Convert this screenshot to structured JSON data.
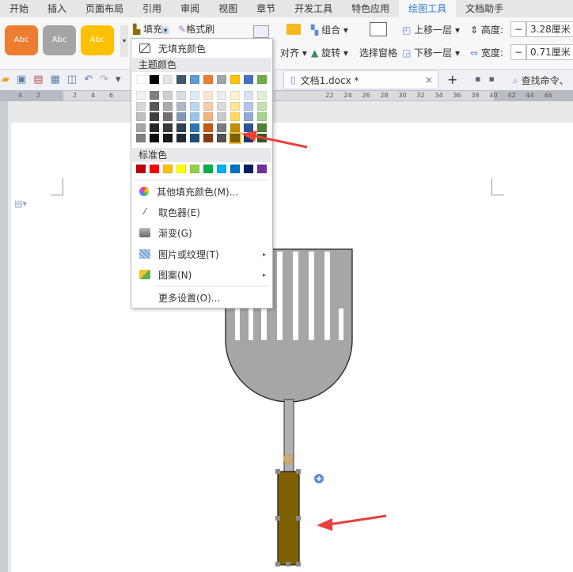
{
  "tabs": [
    "开始",
    "插入",
    "页面布局",
    "引用",
    "审阅",
    "视图",
    "章节",
    "开发工具",
    "特色应用",
    "绘图工具",
    "文档助手"
  ],
  "active_tab": "绘图工具",
  "ribbon": {
    "styles": [
      {
        "label": "Abc",
        "color": "#ed7d31"
      },
      {
        "label": "Abc",
        "color": "#a5a5a5"
      },
      {
        "label": "Abc",
        "color": "#ffc000"
      }
    ],
    "fill": "填充",
    "format_painter": "格式刷",
    "align": "对齐",
    "group": "组合",
    "rotate": "旋转",
    "selection_pane": "选择窗格",
    "bring_forward": "上移一层",
    "send_backward": "下移一层",
    "height_label": "高度:",
    "height_value": "3.28厘米",
    "width_label": "宽度:",
    "width_value": "0.71厘米",
    "minus": "−"
  },
  "doc_tab": {
    "title": "文档1.docx *",
    "close": "×",
    "add": "+"
  },
  "search": "查找命令、",
  "ruler_ticks": [
    "4",
    "2",
    "",
    "2",
    "4",
    "6",
    "",
    "",
    "",
    "",
    "",
    "",
    "",
    "",
    "",
    "",
    "",
    "22",
    "24",
    "26",
    "28",
    "30",
    "32",
    "34",
    "36",
    "38",
    "40",
    "42",
    "44",
    "46"
  ],
  "menu": {
    "no_fill": "无填充颜色",
    "theme_header": "主题颜色",
    "standard_header": "标准色",
    "more_colors": "其他填充颜色(M)...",
    "eyedropper": "取色器(E)",
    "gradient": "渐变(G)",
    "picture": "图片或纹理(T)",
    "pattern": "图案(N)",
    "more_settings": "更多设置(O)...",
    "theme_colors": [
      "#ffffff",
      "#000000",
      "#e7e6e6",
      "#44546a",
      "#5b9bd5",
      "#ed7d31",
      "#a5a5a5",
      "#ffc000",
      "#4472c4",
      "#70ad47"
    ],
    "shades": [
      [
        "#f2f2f2",
        "#7f7f7f",
        "#d0cece",
        "#d6dce4",
        "#deebf6",
        "#fbe5d5",
        "#ededed",
        "#fff2cc",
        "#d9e2f3",
        "#e2efd9"
      ],
      [
        "#d8d8d8",
        "#595959",
        "#aeabab",
        "#adb9ca",
        "#bdd7ee",
        "#f7cbac",
        "#dbdbdb",
        "#fee599",
        "#b4c6e7",
        "#c5e0b3"
      ],
      [
        "#bfbfbf",
        "#3f3f3f",
        "#757070",
        "#8496b0",
        "#9cc3e5",
        "#f4b183",
        "#c9c9c9",
        "#ffd965",
        "#8eaadb",
        "#a8d08d"
      ],
      [
        "#a5a5a5",
        "#262626",
        "#3a3838",
        "#323f4f",
        "#2e75b5",
        "#c55a11",
        "#7b7b7b",
        "#bf9000",
        "#2f5496",
        "#538135"
      ],
      [
        "#7f7f7f",
        "#0c0c0c",
        "#171616",
        "#222a35",
        "#1e4e79",
        "#833c0b",
        "#525252",
        "#7f6000",
        "#1f3864",
        "#375623"
      ]
    ],
    "standard_colors": [
      "#c00000",
      "#ff0000",
      "#ffc000",
      "#ffff00",
      "#92d050",
      "#00b050",
      "#00b0f0",
      "#0070c0",
      "#002060",
      "#7030a0"
    ],
    "selected": "#7f6000"
  },
  "shape_colors": {
    "head": "#a6a6a6",
    "handle": "#7f6000",
    "arrow": "#e8403a"
  }
}
